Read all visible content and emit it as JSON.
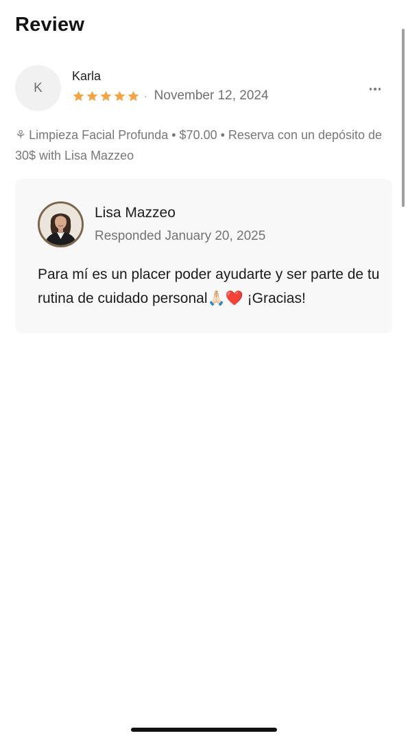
{
  "header": {
    "title": "Review"
  },
  "review": {
    "avatar_initial": "K",
    "reviewer_name": "Karla",
    "rating": 5,
    "rating_max": 5,
    "separator": "·",
    "date": "November 12, 2024",
    "more_icon": "more-horizontal-icon",
    "service_icon": "⚘",
    "service_text": "Limpieza Facial Profunda • $70.00 • Reserva con un depósito de 30$ with Lisa Mazzeo"
  },
  "response": {
    "responder_name": "Lisa Mazzeo",
    "responded_date": "Responded January 20, 2025",
    "text": "Para mí es un placer poder ayudarte y ser parte de tu rutina de cuidado personal🙏🏻❤️ ¡Gracias!"
  },
  "colors": {
    "star": "#F4A340",
    "card_background": "#F8F8F8",
    "secondary_text": "#737373"
  }
}
